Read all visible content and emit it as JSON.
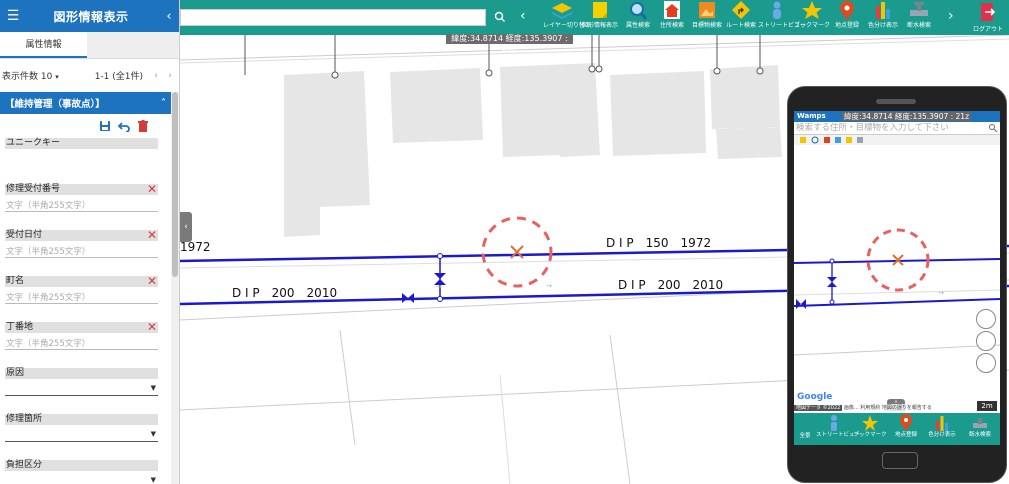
{
  "panel": {
    "title": "図形情報表示",
    "tab_attribute": "属性情報",
    "per_page_label": "表示件数",
    "per_page_value": "10",
    "range_text": "1-1 (全1件)"
  },
  "section": {
    "title": "【維持管理（事故点）】"
  },
  "fields": [
    {
      "label": "ユニークキー"
    },
    {
      "label": "修理受付番号",
      "placeholder": "文字（半角255文字）"
    },
    {
      "label": "受付日付",
      "placeholder": "文字（半角255文字）"
    },
    {
      "label": "町名",
      "placeholder": "文字（半角255文字）"
    },
    {
      "label": "丁番地",
      "placeholder": "文字（半角255文字）"
    },
    {
      "label": "原因"
    },
    {
      "label": "修理箇所"
    },
    {
      "label": "負担区分"
    }
  ],
  "toolbar": {
    "buttons": [
      {
        "label": "レイヤー切り替え",
        "icon": "layers-icon"
      },
      {
        "label": "図形情報表示",
        "icon": "sticky-note-icon"
      },
      {
        "label": "属性検索",
        "icon": "magnifier-icon"
      },
      {
        "label": "住所検索",
        "icon": "house-icon"
      },
      {
        "label": "目標物検索",
        "icon": "picture-icon"
      },
      {
        "label": "ルート検索",
        "icon": "route-sign-icon"
      },
      {
        "label": "ストリートビュー",
        "icon": "pegman-icon"
      },
      {
        "label": "ブックマーク",
        "icon": "star-icon"
      },
      {
        "label": "地点登録",
        "icon": "map-pin-icon"
      },
      {
        "label": "色分け表示",
        "icon": "color-bars-icon"
      },
      {
        "label": "断水検索",
        "icon": "valve-icon"
      }
    ],
    "logout_label": "ログアウト"
  },
  "coord": "緯度:34.8714 経度:135.3907 : 21z",
  "map": {
    "pipe_label_1": "D I P　150　1972",
    "pipe_label_2": "D I P　200　2010",
    "pipe_label_3": "D I P　200　2010",
    "pipe_label_left": "1972"
  },
  "phone": {
    "logo": "Wamps",
    "coord": "緯度:34.8714 経度:135.3907 : 21z",
    "search_placeholder": "検索する住所・目標物を入力して下さい",
    "google": "Google",
    "map_data_prefix": "地図データ ©2022",
    "map_data_suffix": "画像... 利用規約  地図の誤りを報告する",
    "scale": "2m",
    "buttons": [
      {
        "label": "全景",
        "icon": "back-icon"
      },
      {
        "label": "ストリートビュー",
        "icon": "pegman-icon"
      },
      {
        "label": "ブックマーク",
        "icon": "star-icon"
      },
      {
        "label": "地点登録",
        "icon": "map-pin-icon"
      },
      {
        "label": "色分け表示",
        "icon": "color-bars-icon"
      },
      {
        "label": "断水検索",
        "icon": "valve-icon"
      }
    ]
  },
  "colors": {
    "header_blue": "#1e73be",
    "toolbar_teal": "#1a9b8e",
    "pipe_blue": "#1a1acc",
    "marker_red": "#e86060",
    "delete_red": "#d43c3c",
    "logout_red": "#e0304a"
  }
}
